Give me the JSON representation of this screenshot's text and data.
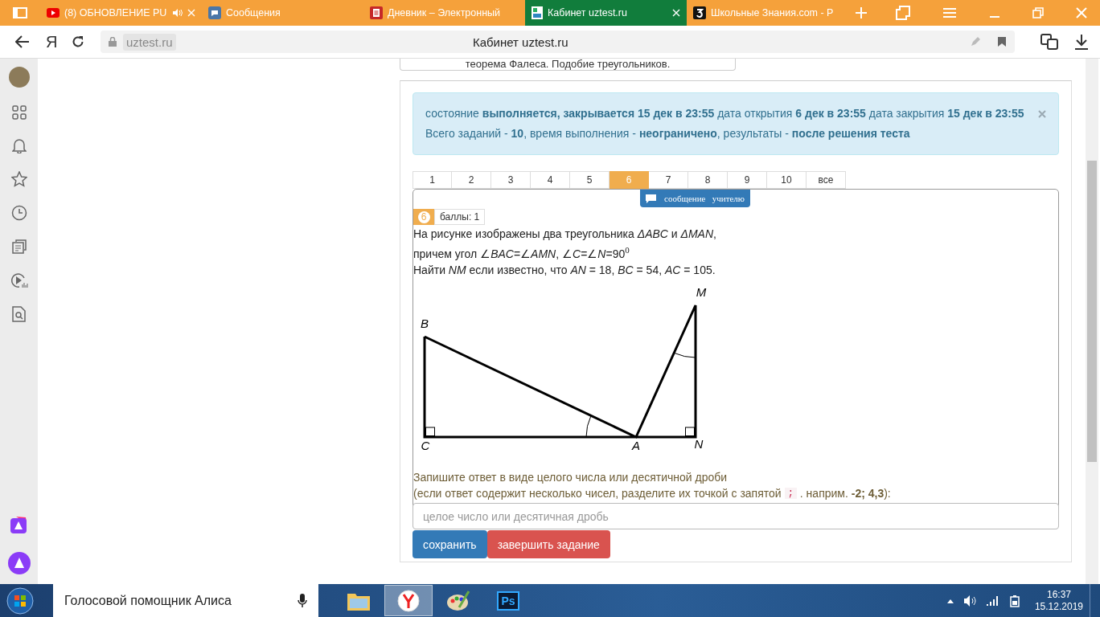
{
  "browser_tabs": [
    {
      "kind": "video",
      "title": "(8) ОБНОВЛЕНИЕ PU",
      "audio": true,
      "closable": true,
      "selected": false
    },
    {
      "kind": "chat",
      "title": "Сообщения",
      "audio": false,
      "closable": false,
      "selected": false
    },
    {
      "kind": "diary",
      "title": "Дневник – Электронный",
      "audio": false,
      "closable": false,
      "selected": false
    },
    {
      "kind": "site",
      "title": "Кабинет uztest.ru",
      "audio": false,
      "closable": true,
      "selected": true
    },
    {
      "kind": "znania",
      "title": "Школьные Знания.com - Р",
      "audio": false,
      "closable": false,
      "selected": false
    }
  ],
  "address_bar": {
    "logo": "Я",
    "url": "uztest.ru",
    "page_title": "Кабинет uztest.ru"
  },
  "topic_card": {
    "text": "теорема Фалеса. Подобие треугольников."
  },
  "alert": {
    "lines": [
      "состояние **выполняется, закрывается 15 дек в 23:55** дата открытия **6 дек в 23:55** дата закрытия **15 дек в 23:55**",
      "Всего заданий - **10**, время выполнения - **неограничено**, результаты - **после решения теста**"
    ]
  },
  "pagination": [
    {
      "label": "1",
      "selected": false
    },
    {
      "label": "2",
      "selected": false
    },
    {
      "label": "3",
      "selected": false
    },
    {
      "label": "4",
      "selected": false
    },
    {
      "label": "5",
      "selected": false
    },
    {
      "label": "6",
      "selected": true
    },
    {
      "label": "7",
      "selected": false
    },
    {
      "label": "8",
      "selected": false
    },
    {
      "label": "9",
      "selected": false
    },
    {
      "label": "10",
      "selected": false
    },
    {
      "label": "все",
      "selected": false
    }
  ],
  "message_button": "сообщение   учителю",
  "task": {
    "number": "6",
    "points": "баллы: 1",
    "text_lines": [
      "На рисунке изображены два треугольника *ΔABC* и *ΔMAN*,",
      "причем угол ∠*BAC*=∠*AMN*, ∠*C*=∠*N*=90$^{0}$",
      "Найти *NM* если известно, что *AN* = 18, *BC* = 54, *AC* = 105."
    ]
  },
  "diagram": {
    "labels": [
      "M",
      "B",
      "C",
      "A",
      "N"
    ]
  },
  "answer": {
    "instruction": "Запишите ответ в виде целого числа или десятичной дроби",
    "hint_before": "(если ответ содержит несколько чисел, разделите их точкой с запятой",
    "code": ";",
    "hint_after": ". наприм. **-2; 4,3**):",
    "placeholder": "целое число или десятичная дробь"
  },
  "buttons": [
    {
      "label": "сохранить",
      "kind": "primary"
    },
    {
      "label": "завершить задание",
      "kind": "danger"
    }
  ],
  "taskbar": {
    "search": "Голосовой помощник Алиса",
    "apps": [
      {
        "kind": "explorer",
        "selected": false
      },
      {
        "kind": "browser",
        "selected": true
      },
      {
        "kind": "paint",
        "selected": false
      },
      {
        "kind": "photoshop",
        "label": "Ps",
        "selected": false
      }
    ],
    "time": "16:37",
    "date": "15.12.2019"
  }
}
